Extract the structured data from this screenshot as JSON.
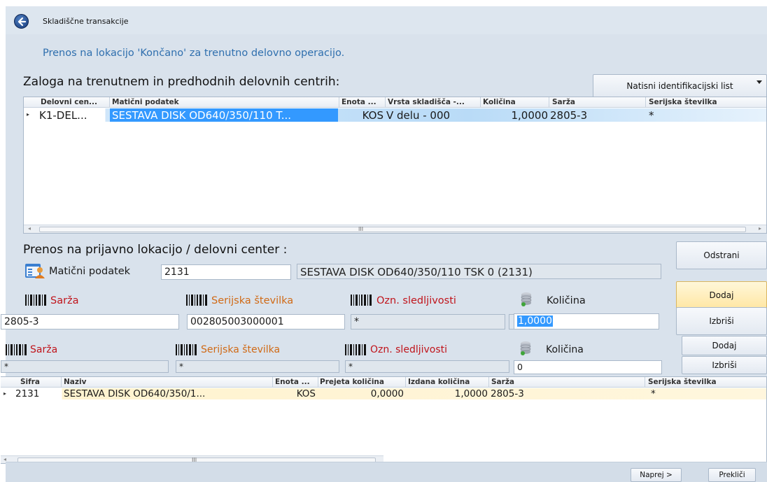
{
  "window": {
    "title": "Skladiščne transakcije"
  },
  "hint": "Prenos na lokacijo 'Končano' za trenutno delovno operacijo.",
  "stock": {
    "title": "Zaloga na trenutnem in predhodnih delovnih centrih:",
    "print_button": "Natisni identifikacijski list",
    "columns": [
      "Delovni cen...",
      "Matični podatek",
      "Enota ...",
      "Vrsta skladišča -...",
      "Količina",
      "Sarža",
      "Serijska številka"
    ],
    "rows": [
      [
        "K1-DEL...",
        "SESTAVA DISK OD640/350/110 T...",
        "KOS",
        "V delu - 000",
        "1,0000",
        "2805-3",
        "*"
      ]
    ]
  },
  "transfer": {
    "title": "Prenos na prijavno lokacijo / delovni center :",
    "master_label": "Matični podatek",
    "master_value": "2131",
    "master_desc": "SESTAVA DISK OD640/350/110 TSK 0 (2131)",
    "remove_button": "Odstrani",
    "add_button": "Dodaj",
    "delete_button": "Izbriši",
    "labels": {
      "batch": "Sarža",
      "serial": "Serijska številka",
      "trace": "Ozn. sledljivosti",
      "qty": "Količina"
    },
    "values": {
      "batch": "2805-3",
      "serial": "002805003000001",
      "trace": "*",
      "qty": "1,0000"
    }
  },
  "second": {
    "labels": {
      "batch": "Sarža",
      "serial": "Serijska številka",
      "trace": "Ozn. sledljivosti",
      "qty": "Količina"
    },
    "values": {
      "batch": "*",
      "serial": "*",
      "trace": "*",
      "qty": "0"
    },
    "add_button": "Dodaj",
    "delete_button": "Izbriši"
  },
  "items": {
    "columns": [
      "Šifra",
      "Naziv",
      "Enota ...",
      "Prejeta količina",
      "Izdana količina",
      "Sarža",
      "Serijska številka"
    ],
    "rows": [
      [
        "2131",
        "SESTAVA DISK OD640/350/1...",
        "KOS",
        "0,0000",
        "1,0000",
        "2805-3",
        "*"
      ]
    ]
  },
  "footer": {
    "next_button": "Naprej >",
    "cancel_button": "Prekliči"
  },
  "colors": {
    "accent": "#2f6fae",
    "selection": "#3399ff",
    "required_label": "#c0141b",
    "optional_label": "#d06a16"
  }
}
